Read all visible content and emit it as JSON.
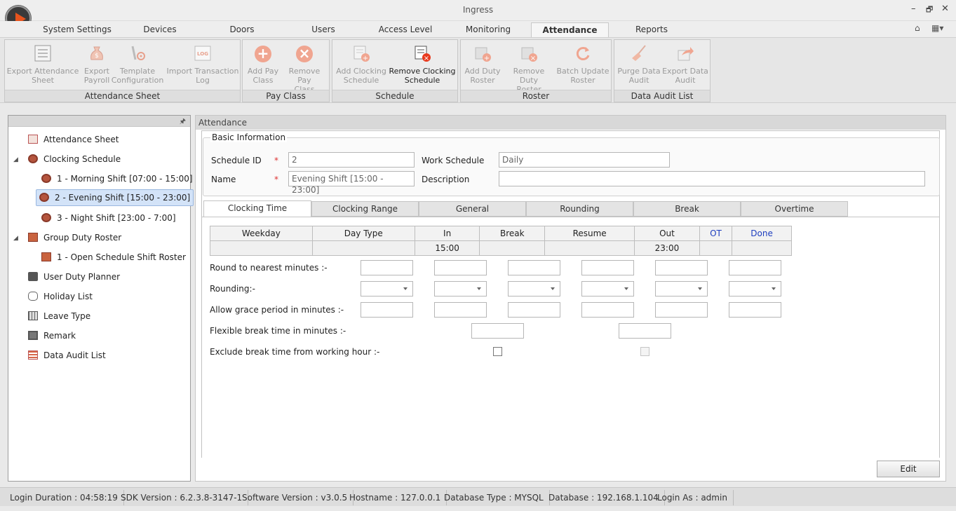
{
  "window": {
    "title": "Ingress",
    "minimize": "–",
    "restore": "🗗",
    "close": "✕"
  },
  "menu_tabs": [
    "System Settings",
    "Devices",
    "Doors",
    "Users",
    "Access Level",
    "Monitoring",
    "Attendance",
    "Reports"
  ],
  "active_tab": "Attendance",
  "quick": {
    "home": "⌂",
    "layout": "▦▾"
  },
  "ribbon": {
    "groups": [
      {
        "title": "Attendance Sheet",
        "buttons": [
          "Export Attendance Sheet",
          "Export Payroll",
          "Template Configuration",
          "Import Transaction Log"
        ]
      },
      {
        "title": "Pay Class",
        "buttons": [
          "Add Pay Class",
          "Remove Pay Class"
        ]
      },
      {
        "title": "Schedule",
        "buttons": [
          "Add Clocking Schedule",
          "Remove Clocking Schedule"
        ]
      },
      {
        "title": "Roster",
        "buttons": [
          "Add Duty Roster",
          "Remove Duty Roster",
          "Batch Update Roster"
        ]
      },
      {
        "title": "Data Audit List",
        "buttons": [
          "Purge Data Audit",
          "Export Data Audit"
        ]
      }
    ],
    "labels": {
      "export_attendance": [
        "Export Attendance",
        "Sheet"
      ],
      "export_payroll": [
        "Export",
        "Payroll"
      ],
      "template_config": [
        "Template",
        "Configuration"
      ],
      "import_log": [
        "Import Transaction",
        "Log"
      ],
      "add_pay": [
        "Add Pay",
        "Class"
      ],
      "remove_pay": [
        "Remove Pay",
        "Class"
      ],
      "add_clock": [
        "Add Clocking",
        "Schedule"
      ],
      "remove_clock": [
        "Remove Clocking",
        "Schedule"
      ],
      "add_roster": [
        "Add Duty",
        "Roster"
      ],
      "remove_roster": [
        "Remove Duty",
        "Roster"
      ],
      "batch_roster": [
        "Batch Update",
        "Roster"
      ],
      "purge_audit": [
        "Purge Data",
        "Audit"
      ],
      "export_audit": [
        "Export Data",
        "Audit"
      ]
    },
    "icon_glyphs": {
      "log": "LOG",
      "plus": "+",
      "x": "×"
    }
  },
  "tree": {
    "pin": "🖈",
    "items": [
      "Attendance Sheet",
      "Clocking Schedule",
      "1 - Morning Shift [07:00 - 15:00]",
      "2 - Evening Shift [15:00 - 23:00]",
      "3 - Night Shift [23:00 - 7:00]",
      "Group Duty Roster",
      "1 - Open Schedule Shift Roster",
      "User Duty Planner",
      "Holiday List",
      "Leave Type",
      "Remark",
      "Data Audit List"
    ],
    "expander": "◢"
  },
  "content": {
    "header": "Attendance",
    "basic_info": {
      "legend": "Basic Information",
      "schedule_id_label": "Schedule ID",
      "schedule_id": "2",
      "name_label": "Name",
      "name": "Evening Shift [15:00 - 23:00]",
      "work_schedule_label": "Work Schedule",
      "work_schedule": "Daily",
      "description_label": "Description",
      "description": "",
      "required_mark": "*"
    },
    "sub_tabs": [
      "Clocking Time",
      "Clocking Range",
      "General",
      "Rounding",
      "Break",
      "Overtime"
    ],
    "grid": {
      "headers": [
        "Weekday",
        "Day Type",
        "In",
        "Break",
        "Resume",
        "Out",
        "OT",
        "Done"
      ],
      "row": [
        "",
        "",
        "15:00",
        "",
        "",
        "23:00",
        "",
        ""
      ]
    },
    "rows": {
      "round": "Round to nearest minutes :-",
      "rounding": "Rounding:-",
      "grace": "Allow grace period in minutes :-",
      "flex_break": "Flexible break time in minutes :-",
      "exclude_break": "Exclude break time from working hour :-"
    },
    "edit_button": "Edit"
  },
  "status": {
    "login_duration": "Login Duration : 04:58:19",
    "sdk": "SDK Version : 6.2.3.8-3147-1",
    "software": "Software Version : v3.0.5",
    "hostname": "Hostname : 127.0.0.1",
    "db_type": "Database Type : MYSQL",
    "database": "Database : 192.168.1.104",
    "login_as": "Login As : admin"
  },
  "colors": {
    "accent": "#e8541d",
    "link_blue": "#1f3fbf",
    "selection": "#d3e3f8",
    "required": "#dd3333"
  }
}
